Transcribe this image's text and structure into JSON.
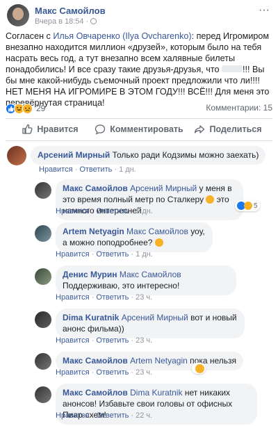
{
  "post": {
    "author": "Макс Самойлов",
    "time": "Вчера в 18:54 ·",
    "more_icon": "···",
    "text_1": "Согласен с ",
    "mention": "Илья Овчаренко (Ilya Ovcharenko)",
    "text_2": ": перед Игромиром внезапно находится миллион «друзей», которым было на тебя насрать весь год, а тут внезапно всем халявные билеты понадобились! И все сразу такие друзья-друзья, что ",
    "text_3": "!!! Вы бы мне какой-нибудь съемочный проект предложили что ли!!!! НЕТ МЕНЯ НА ИГРОМИРЕ В ЭТОМ ГОДУ!!! ВСЁ!!! Для меня это перевёрнутая страница!",
    "reactions_count": "29",
    "comments_count": "Комментарии: 15"
  },
  "actions": {
    "like": "Нравится",
    "comment": "Комментировать",
    "share": "Поделиться"
  },
  "comments": [
    {
      "name": "Арсений Мирный",
      "mention": "",
      "text": "Только ради Кодзимы можно заехать)",
      "like": "Нравится",
      "reply": "Ответить",
      "time": "1 дн."
    },
    {
      "name": "Макс Самойлов",
      "mention": "Арсений Мирный",
      "text_a": "у меня в это время",
      "text_b": "полный метр по Сталкеру",
      "text_c": "это намного интересней",
      "like": "Нравится",
      "reply": "Ответить",
      "time": "1 дн.",
      "reaction_count": "5"
    },
    {
      "name": "Artem Netyagin",
      "mention": "Макс Самойлов",
      "text_a": "уоу, а можно",
      "text_b": "поподробнее?",
      "like": "Нравится",
      "reply": "Ответить",
      "time": "1 дн."
    },
    {
      "name": "Денис Мурин",
      "mention": "Макс Самойлов",
      "text_a": "Поддерживаю, это",
      "text_b": "интересно!",
      "like": "Нравится",
      "reply": "Ответить",
      "time": "23 ч."
    },
    {
      "name": "Dima Kuratnik",
      "mention": "Арсений Мирный",
      "text_a": "вот и новый анонс",
      "text_b": "фильма))",
      "like": "Нравится",
      "reply": "Ответить",
      "time": "23 ч."
    },
    {
      "name": "Макс Самойлов",
      "mention": "Artem Netyagin",
      "text_a": "пока нельзя",
      "like": "Нравится",
      "reply": "Ответить",
      "time": "23 ч."
    },
    {
      "name": "Макс Самойлов",
      "mention": "Dima Kuratnik",
      "text_a": "нет никаких анонсов!",
      "text_b": "Избавьте свои головы от офисных Пиар-схем!",
      "like": "Нравится",
      "reply": "Ответить",
      "time": "22 ч."
    }
  ],
  "colors": {
    "link": "#385898",
    "bubble": "#f2f3f5",
    "meta": "#90949c",
    "like_blue": "#1877f2",
    "emoji_yellow": "#f7b125"
  }
}
